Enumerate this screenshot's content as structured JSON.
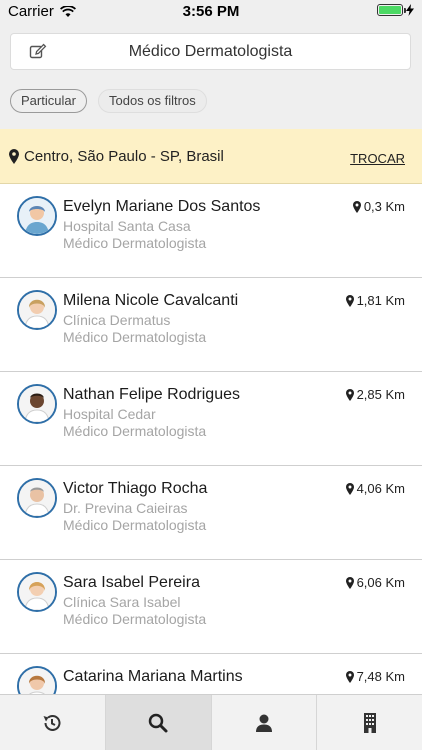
{
  "status": {
    "carrier": "Carrier",
    "time": "3:56 PM"
  },
  "search": {
    "value": "Médico Dermatologista"
  },
  "filters": {
    "particular": "Particular",
    "all": "Todos os filtros"
  },
  "location": {
    "text": "Centro, São Paulo - SP, Brasil",
    "action": "TROCAR"
  },
  "doctors": [
    {
      "name": "Evelyn Mariane Dos Santos",
      "place": "Hospital Santa Casa",
      "specialty": "Médico Dermatologista",
      "distance": "0,3 Km",
      "avatar": "female-doctor-avatar-1"
    },
    {
      "name": "Milena Nicole Cavalcanti",
      "place": "Clínica Dermatus",
      "specialty": "Médico Dermatologista",
      "distance": "1,81 Km",
      "avatar": "female-doctor-avatar-2"
    },
    {
      "name": "Nathan Felipe Rodrigues",
      "place": "Hospital Cedar",
      "specialty": "Médico Dermatologista",
      "distance": "2,85 Km",
      "avatar": "male-doctor-avatar-1"
    },
    {
      "name": "Victor Thiago Rocha",
      "place": "Dr. Previna Caieiras",
      "specialty": "Médico Dermatologista",
      "distance": "4,06 Km",
      "avatar": "male-doctor-avatar-2"
    },
    {
      "name": "Sara Isabel Pereira",
      "place": "Clínica Sara Isabel",
      "specialty": "Médico Dermatologista",
      "distance": "6,06 Km",
      "avatar": "female-doctor-avatar-3"
    },
    {
      "name": "Catarina Mariana Martins",
      "place": "",
      "specialty": "",
      "distance": "7,48 Km",
      "avatar": "female-doctor-avatar-4"
    }
  ],
  "tabs": [
    {
      "icon": "history-icon",
      "active": false
    },
    {
      "icon": "search-icon",
      "active": true
    },
    {
      "icon": "user-icon",
      "active": false
    },
    {
      "icon": "building-icon",
      "active": false
    }
  ],
  "colors": {
    "accent": "#2f6fa8",
    "location_bg": "#fdf1c6",
    "battery": "#4cd964"
  }
}
